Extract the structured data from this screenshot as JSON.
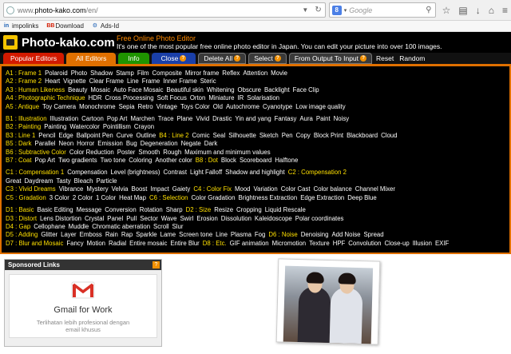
{
  "browser": {
    "url_prefix": "www.",
    "url_domain": "photo-kako.com",
    "url_path": "/en/",
    "search_placeholder": "Google",
    "search_engine_letter": "8",
    "bookmarks": [
      "impolinks",
      "Download",
      "Ads-Id"
    ]
  },
  "site": {
    "logo_text": "Photo-kako.com",
    "tagline_title": "Free Online Photo Editor",
    "tagline_desc": "It's one of the most popular free online photo editor in Japan. You can edit your picture into over 100 images."
  },
  "tabs": [
    {
      "label": "Popular Editors",
      "style": "red"
    },
    {
      "label": "All Editors",
      "style": "orange"
    },
    {
      "label": "Info",
      "style": "green"
    },
    {
      "label": "Close",
      "style": "blue",
      "badge": "?"
    },
    {
      "label": "Delete All",
      "style": "grey",
      "badge": "?"
    },
    {
      "label": "Select",
      "style": "grey",
      "badge": "?"
    },
    {
      "label": "From Output To Input",
      "style": "grey",
      "badge": "?"
    },
    {
      "label": "Reset",
      "style": "plain"
    },
    {
      "label": "Random",
      "style": "plain"
    }
  ],
  "editor_rows": [
    {
      "gap": false,
      "parts": [
        {
          "g": "A1 : Frame 1"
        },
        {
          "i": "Polaroid"
        },
        {
          "i": "Photo"
        },
        {
          "i": "Shadow"
        },
        {
          "i": "Stamp"
        },
        {
          "i": "Film"
        },
        {
          "i": "Composite"
        },
        {
          "i": "Mirror frame"
        },
        {
          "i": "Reflex"
        },
        {
          "i": "Attention"
        },
        {
          "i": "Movie"
        }
      ]
    },
    {
      "gap": false,
      "parts": [
        {
          "g": "A2 : Frame 2"
        },
        {
          "i": "Heart"
        },
        {
          "i": "Vignette"
        },
        {
          "i": "Clear Frame"
        },
        {
          "i": "Line"
        },
        {
          "i": "Frame"
        },
        {
          "i": "Inner Frame"
        },
        {
          "i": "Steric"
        }
      ]
    },
    {
      "gap": false,
      "parts": [
        {
          "g": "A3 : Human Likeness"
        },
        {
          "i": "Beauty"
        },
        {
          "i": "Mosaic"
        },
        {
          "i": "Auto Face Mosaic"
        },
        {
          "i": "Beautiful skin"
        },
        {
          "i": "Whitening"
        },
        {
          "i": "Obscure"
        },
        {
          "i": "Backlight"
        },
        {
          "i": "Face Clip"
        }
      ]
    },
    {
      "gap": false,
      "parts": [
        {
          "g": "A4 : Photographic Technique"
        },
        {
          "i": "HDR"
        },
        {
          "i": "Cross Processing"
        },
        {
          "i": "Soft Focus"
        },
        {
          "i": "Orton"
        },
        {
          "i": "Miniature"
        },
        {
          "i": "IR"
        },
        {
          "i": "Solarisation"
        }
      ]
    },
    {
      "gap": false,
      "parts": [
        {
          "g": "A5 : Antique"
        },
        {
          "i": "Toy Camera"
        },
        {
          "i": "Monochrome"
        },
        {
          "i": "Sepia"
        },
        {
          "i": "Retro"
        },
        {
          "i": "Vintage"
        },
        {
          "i": "Toys Color"
        },
        {
          "i": "Old"
        },
        {
          "i": "Autochrome"
        },
        {
          "i": "Cyanotype"
        },
        {
          "i": "Low image quality"
        }
      ]
    },
    {
      "gap": true,
      "parts": [
        {
          "g": "B1 : Illustration"
        },
        {
          "i": "Illustration"
        },
        {
          "i": "Cartoon"
        },
        {
          "i": "Pop Art"
        },
        {
          "i": "Marchen"
        },
        {
          "i": "Trace"
        },
        {
          "i": "Plane"
        },
        {
          "i": "Vivid"
        },
        {
          "i": "Drastic"
        },
        {
          "i": "Yin and yang"
        },
        {
          "i": "Fantasy"
        },
        {
          "i": "Aura"
        },
        {
          "i": "Paint"
        },
        {
          "i": "Noisy"
        }
      ]
    },
    {
      "gap": false,
      "parts": [
        {
          "g": "B2 : Painting"
        },
        {
          "i": "Painting"
        },
        {
          "i": "Watercolor"
        },
        {
          "i": "Pointillism"
        },
        {
          "i": "Crayon"
        }
      ]
    },
    {
      "gap": false,
      "parts": [
        {
          "g": "B3 : Line 1"
        },
        {
          "i": "Pencil"
        },
        {
          "i": "Edge"
        },
        {
          "i": "Ballpoint Pen"
        },
        {
          "i": "Curve"
        },
        {
          "i": "Outline"
        },
        {
          "g": "B4 : Line 2"
        },
        {
          "i": "Comic"
        },
        {
          "i": "Seal"
        },
        {
          "i": "Silhouette"
        },
        {
          "i": "Sketch"
        },
        {
          "i": "Pen"
        },
        {
          "i": "Copy"
        },
        {
          "i": "Block Print"
        },
        {
          "i": "Blackboard"
        },
        {
          "i": "Cloud"
        }
      ]
    },
    {
      "gap": false,
      "parts": [
        {
          "g": "B5 : Dark"
        },
        {
          "i": "Parallel"
        },
        {
          "i": "Neon"
        },
        {
          "i": "Horror"
        },
        {
          "i": "Emission"
        },
        {
          "i": "Bug"
        },
        {
          "i": "Degeneration"
        },
        {
          "i": "Negate"
        },
        {
          "i": "Dark"
        }
      ]
    },
    {
      "gap": false,
      "parts": [
        {
          "g": "B6 : Subtractive Color"
        },
        {
          "i": "Color Reduction"
        },
        {
          "i": "Poster"
        },
        {
          "i": "Smooth"
        },
        {
          "i": "Rough"
        },
        {
          "i": "Maximum and minimum values"
        }
      ]
    },
    {
      "gap": false,
      "parts": [
        {
          "g": "B7 : Coat"
        },
        {
          "i": "Pop Art"
        },
        {
          "i": "Two gradients"
        },
        {
          "i": "Two tone"
        },
        {
          "i": "Coloring"
        },
        {
          "i": "Another color"
        },
        {
          "g": "B8 : Dot"
        },
        {
          "i": "Block"
        },
        {
          "i": "Scoreboard"
        },
        {
          "i": "Halftone"
        }
      ]
    },
    {
      "gap": true,
      "parts": [
        {
          "g": "C1 : Compensation 1"
        },
        {
          "i": "Compensation"
        },
        {
          "i": "Level (brightness)"
        },
        {
          "i": "Contrast"
        },
        {
          "i": "Light Falloff"
        },
        {
          "i": "Shadow and highlight"
        },
        {
          "g": "C2 : Compensation 2"
        }
      ]
    },
    {
      "gap": false,
      "parts": [
        {
          "i0": "Great"
        },
        {
          "i": "Daydream"
        },
        {
          "i": "Tasty"
        },
        {
          "i": "Bleach"
        },
        {
          "i": "Particle"
        }
      ]
    },
    {
      "gap": false,
      "parts": [
        {
          "g": "C3 : Vivid Dreams"
        },
        {
          "i": "Vibrance"
        },
        {
          "i": "Mystery"
        },
        {
          "i": "Velvia"
        },
        {
          "i": "Boost"
        },
        {
          "i": "Impact"
        },
        {
          "i": "Gaiety"
        },
        {
          "g": "C4 : Color Fix"
        },
        {
          "i": "Mood"
        },
        {
          "i": "Variation"
        },
        {
          "i": "Color Cast"
        },
        {
          "i": "Color balance"
        },
        {
          "i": "Channel Mixer"
        }
      ]
    },
    {
      "gap": false,
      "parts": [
        {
          "g": "C5 : Gradation"
        },
        {
          "i": "3 Color"
        },
        {
          "i": "2 Color"
        },
        {
          "i": "1 Color"
        },
        {
          "i": "Heat Map"
        },
        {
          "g": "C6 : Selection"
        },
        {
          "i": "Color Gradation"
        },
        {
          "i": "Brightness Extraction"
        },
        {
          "i": "Edge Extraction"
        },
        {
          "i": "Deep Blue"
        }
      ]
    },
    {
      "gap": true,
      "parts": [
        {
          "g": "D1 : Basic"
        },
        {
          "i": "Basic Editing"
        },
        {
          "i": "Message"
        },
        {
          "i": "Conversion"
        },
        {
          "i": "Rotation"
        },
        {
          "i": "Sharp"
        },
        {
          "g": "D2 : Size"
        },
        {
          "i": "Resize"
        },
        {
          "i": "Cropping"
        },
        {
          "i": "Liquid Rescale"
        }
      ]
    },
    {
      "gap": false,
      "parts": [
        {
          "g": "D3 : Distort"
        },
        {
          "i": "Lens Distortion"
        },
        {
          "i": "Crystal"
        },
        {
          "i": "Panel"
        },
        {
          "i": "Pull"
        },
        {
          "i": "Sector"
        },
        {
          "i": "Wave"
        },
        {
          "i": "Swirl"
        },
        {
          "i": "Erosion"
        },
        {
          "i": "Dissolution"
        },
        {
          "i": "Kaleidoscope"
        },
        {
          "i": "Polar coordinates"
        }
      ]
    },
    {
      "gap": false,
      "parts": [
        {
          "g": "D4 : Gap"
        },
        {
          "i": "Cellophane"
        },
        {
          "i": "Muddle"
        },
        {
          "i": "Chromatic aberration"
        },
        {
          "i": "Scroll"
        },
        {
          "i": "Slur"
        }
      ]
    },
    {
      "gap": false,
      "parts": [
        {
          "g": "D5 : Adding"
        },
        {
          "i": "Glitter"
        },
        {
          "i": "Layer"
        },
        {
          "i": "Emboss"
        },
        {
          "i": "Rain"
        },
        {
          "i": "Rap"
        },
        {
          "i": "Sparkle"
        },
        {
          "i": "Lame"
        },
        {
          "i": "Screen tone"
        },
        {
          "i": "Line"
        },
        {
          "i": "Plasma"
        },
        {
          "i": "Fog"
        },
        {
          "g": "D6 : Noise"
        },
        {
          "i": "Denoising"
        },
        {
          "i": "Add Noise"
        },
        {
          "i": "Spread"
        }
      ]
    },
    {
      "gap": false,
      "parts": [
        {
          "g": "D7 : Blur and Mosaic"
        },
        {
          "i": "Fancy"
        },
        {
          "i": "Motion"
        },
        {
          "i": "Radial"
        },
        {
          "i": "Entire mosaic"
        },
        {
          "i": "Entire Blur"
        },
        {
          "g": "D8 : Etc."
        },
        {
          "i": "GIF animation"
        },
        {
          "i": "Micromotion"
        },
        {
          "i": "Texture"
        },
        {
          "i": "HPF"
        },
        {
          "i": "Convolution"
        },
        {
          "i": "Close-up"
        },
        {
          "i": "Illusion"
        },
        {
          "i": "EXIF"
        }
      ]
    }
  ],
  "sponsor": {
    "title": "Sponsored Links",
    "close_badge": "?",
    "ad_title": "Gmail for Work",
    "ad_desc": "Terlihatan lebih profesional dengan email khusus"
  },
  "colors": {
    "group_label": "#ffe000",
    "accent_orange": "#e07000",
    "tab_red": "#d21a00",
    "tab_green": "#1f9400",
    "tab_blue": "#1a3fa8"
  }
}
